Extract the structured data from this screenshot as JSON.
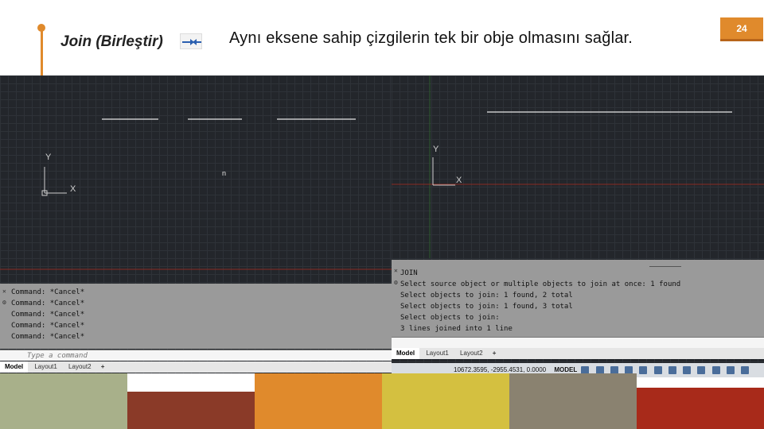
{
  "slide": {
    "title": "Join (Birleştir)",
    "subtitle": "Aynı eksene sahip çizgilerin tek bir obje olmasını sağlar.",
    "page_number": "24"
  },
  "left_panel": {
    "axis_y": "Y",
    "axis_x": "X",
    "cursor_label": "n",
    "command_history": [
      "Command: *Cancel*",
      "Command: *Cancel*",
      "Command: *Cancel*",
      "Command: *Cancel*",
      "Command: *Cancel*"
    ],
    "command_placeholder": "Type a command",
    "tabs": [
      "Model",
      "Layout1",
      "Layout2"
    ]
  },
  "right_panel": {
    "axis_y": "Y",
    "axis_x": "X",
    "command_history": [
      "JOIN",
      "Select source object or multiple objects to join at once: 1 found",
      "Select objects to join: 1 found, 2 total",
      "Select objects to join: 1 found, 3 total",
      "Select objects to join:",
      "3 lines joined into 1 line"
    ],
    "tabs": [
      "Model",
      "Layout1",
      "Layout2"
    ],
    "coordinates": "10672.3595, -2955.4531, 0.0000",
    "model_label": "MODEL"
  },
  "colors": {
    "accent": "#e08a2c",
    "cad_background": "#23262b",
    "red_axis": "#8a2a22",
    "strip": [
      "#a8b08a",
      "#8a3a28",
      "#e08a2c",
      "#d4c040",
      "#8a8270",
      "#a82a1a"
    ]
  }
}
